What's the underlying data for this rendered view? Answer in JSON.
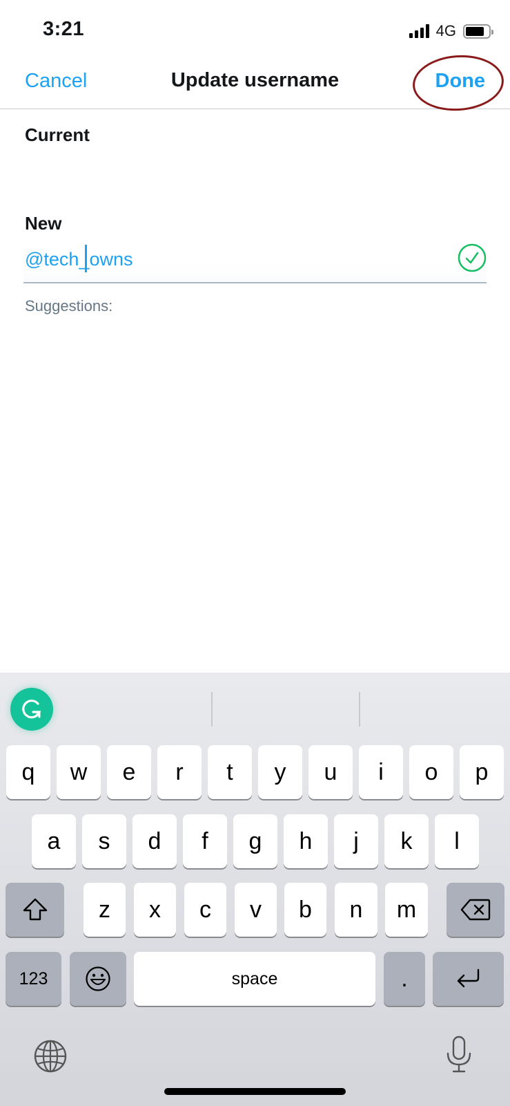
{
  "status_bar": {
    "time": "3:21",
    "network": "4G",
    "signal_bars": 4,
    "battery_level_percent": 80
  },
  "nav": {
    "cancel_label": "Cancel",
    "title": "Update username",
    "done_label": "Done",
    "annotation": "red-ellipse-around-done"
  },
  "form": {
    "current_label": "Current",
    "current_value": "",
    "new_label": "New",
    "new_value": "@tech_owns",
    "cursor_position_after": "@tech_",
    "valid_icon": "check-circle-icon",
    "suggestions_label": "Suggestions:"
  },
  "keyboard": {
    "toolbar_icon": "grammarly-icon",
    "row1": [
      "q",
      "w",
      "e",
      "r",
      "t",
      "y",
      "u",
      "i",
      "o",
      "p"
    ],
    "row2": [
      "a",
      "s",
      "d",
      "f",
      "g",
      "h",
      "j",
      "k",
      "l"
    ],
    "row3": [
      "z",
      "x",
      "c",
      "v",
      "b",
      "n",
      "m"
    ],
    "shift_icon": "shift-icon",
    "delete_icon": "backspace-icon",
    "numbers_label": "123",
    "emoji_icon": "emoji-icon",
    "space_label": "space",
    "period_label": ".",
    "return_icon": "return-icon",
    "globe_icon": "globe-icon",
    "mic_icon": "microphone-icon"
  },
  "colors": {
    "accent": "#1da1f2",
    "valid": "#17bf63",
    "annotation": "#8b1a1a",
    "grammarly": "#15c39a"
  }
}
